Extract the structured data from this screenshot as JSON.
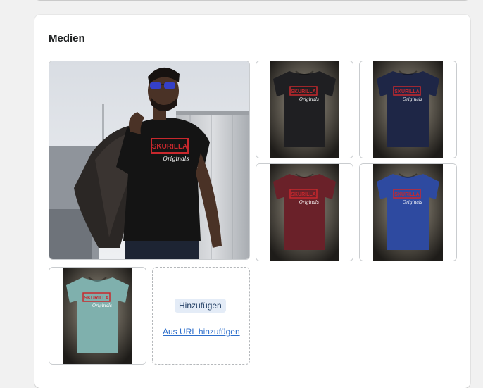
{
  "section": {
    "title": "Medien"
  },
  "media": [
    {
      "kind": "lifestyle-photo",
      "shirt_color": "#141414"
    },
    {
      "kind": "product-photo",
      "shirt_color": "#1f1f22"
    },
    {
      "kind": "product-photo",
      "shirt_color": "#1e2646"
    },
    {
      "kind": "product-photo",
      "shirt_color": "#6a2129"
    },
    {
      "kind": "product-photo",
      "shirt_color": "#2e4aa0"
    },
    {
      "kind": "product-photo",
      "shirt_color": "#7fb0ad"
    }
  ],
  "print": {
    "brand": "SKURILLA",
    "script": "Originals",
    "color": "#c8282d"
  },
  "uploader": {
    "add_label": "Hinzufügen",
    "url_label": "Aus URL hinzufügen"
  },
  "colors": {
    "page_bg": "#f1f1f1",
    "card_bg": "#ffffff",
    "button_bg": "#e4ecf7",
    "link": "#2c6ecb"
  }
}
